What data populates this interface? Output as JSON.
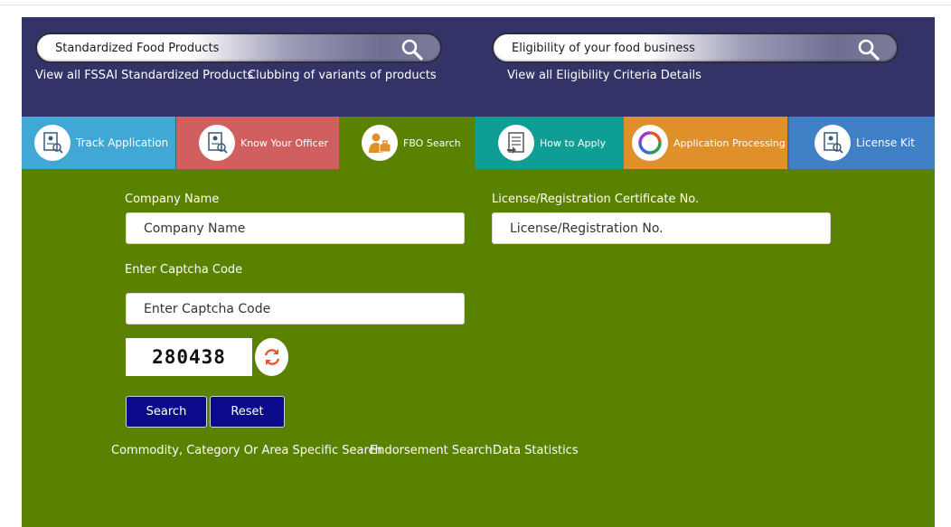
{
  "banner": {
    "search_left": {
      "text": "Standardized Food Products"
    },
    "search_right": {
      "text": "Eligibility of your food business"
    },
    "links": {
      "standardized": "View all FSSAI Standardized Products",
      "clubbing": "Clubbing of variants of products",
      "eligibility": "View all Eligibility Criteria Details"
    }
  },
  "tabs": [
    {
      "label": "Track Application",
      "color": "#41a7d4"
    },
    {
      "label": "Know Your Officer",
      "color": "#d25f5f"
    },
    {
      "label": "FBO Search",
      "color": "#5a8100"
    },
    {
      "label": "How to Apply",
      "color": "#0e9e95"
    },
    {
      "label": "Application Processing",
      "color": "#e0902a"
    },
    {
      "label": "License Kit",
      "color": "#3f80c6"
    }
  ],
  "form": {
    "company_label": "Company Name",
    "company_placeholder": "Company Name",
    "license_label": "License/Registration Certificate No.",
    "license_placeholder": "License/Registration No.",
    "captcha_label": "Enter Captcha Code",
    "captcha_placeholder": "Enter Captcha Code",
    "captcha_code": "280438",
    "search_button": "Search",
    "reset_button": "Reset"
  },
  "bottom_links": {
    "commodity": "Commodity, Category Or Area Specific Search",
    "endorsement": "Endorsement Search",
    "statistics": "Data Statistics"
  },
  "colors": {
    "banner_bg": "#343367",
    "panel_bg": "#5a8100",
    "button_bg": "#0a0a8a",
    "refresh_icon": "#e8562a"
  }
}
